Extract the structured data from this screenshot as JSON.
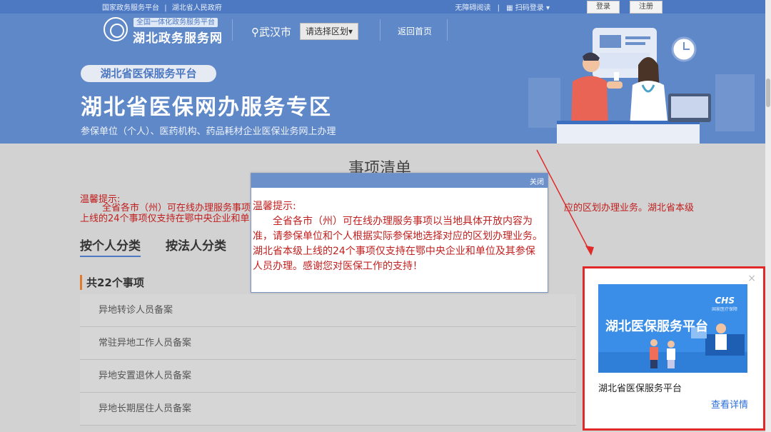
{
  "topbar": {
    "link1": "国家政务服务平台",
    "sep": "|",
    "link2": "湖北省人民政府",
    "accessible": "无障碍阅读",
    "scan_login": "扫码登录 ▾",
    "login_label": "登录",
    "register_label": "注册"
  },
  "header": {
    "logo_tag": "全国一体化政务服务平台",
    "logo_name": "湖北政务服务网",
    "city": "武汉市",
    "region_select": "请选择区划▾",
    "home_link": "返回首页"
  },
  "banner": {
    "pill": "湖北省医保服务平台",
    "title": "湖北省医保网办服务专区",
    "subtitle": "参保单位（个人）、医药机构、药品耗材企业医保业务网上办理"
  },
  "content": {
    "heading": "事项清单",
    "notice_title": "温馨提示:",
    "notice_line1": "全省各市（州）可在线办理服务事项",
    "notice_line1_tail": "应的区划办理业务。湖北省本级",
    "notice_line2": "上线的24个事项仅支持在鄂中央企业和单",
    "tabs": [
      "按个人分类",
      "按法人分类"
    ],
    "count": "共22个事项",
    "items": [
      "异地转诊人员备案",
      "常驻异地工作人员备案",
      "异地安置退休人员备案",
      "异地长期居住人员备案"
    ]
  },
  "dialog": {
    "close_label": "关闭",
    "title": "温馨提示:",
    "body": "全省各市（州）可在线办理服务事项以当地具体开放内容为准，请参保单位和个人根据实际参保地选择对应的区划办理业务。湖北省本级上线的24个事项仅支持在鄂中央企业和单位及其参保人员办理。感谢您对医保工作的支持！"
  },
  "ad": {
    "close_icon": "×",
    "image_title": "湖北医保服务平台",
    "image_logo": "CHS",
    "image_logo_sub": "国家医疗保障",
    "caption": "湖北省医保服务平台",
    "link": "查看详情"
  },
  "colors": {
    "banner": "#5f88c9",
    "accent": "#4d79c2",
    "alert": "#c0201f",
    "ad_border": "#e02a2a"
  }
}
